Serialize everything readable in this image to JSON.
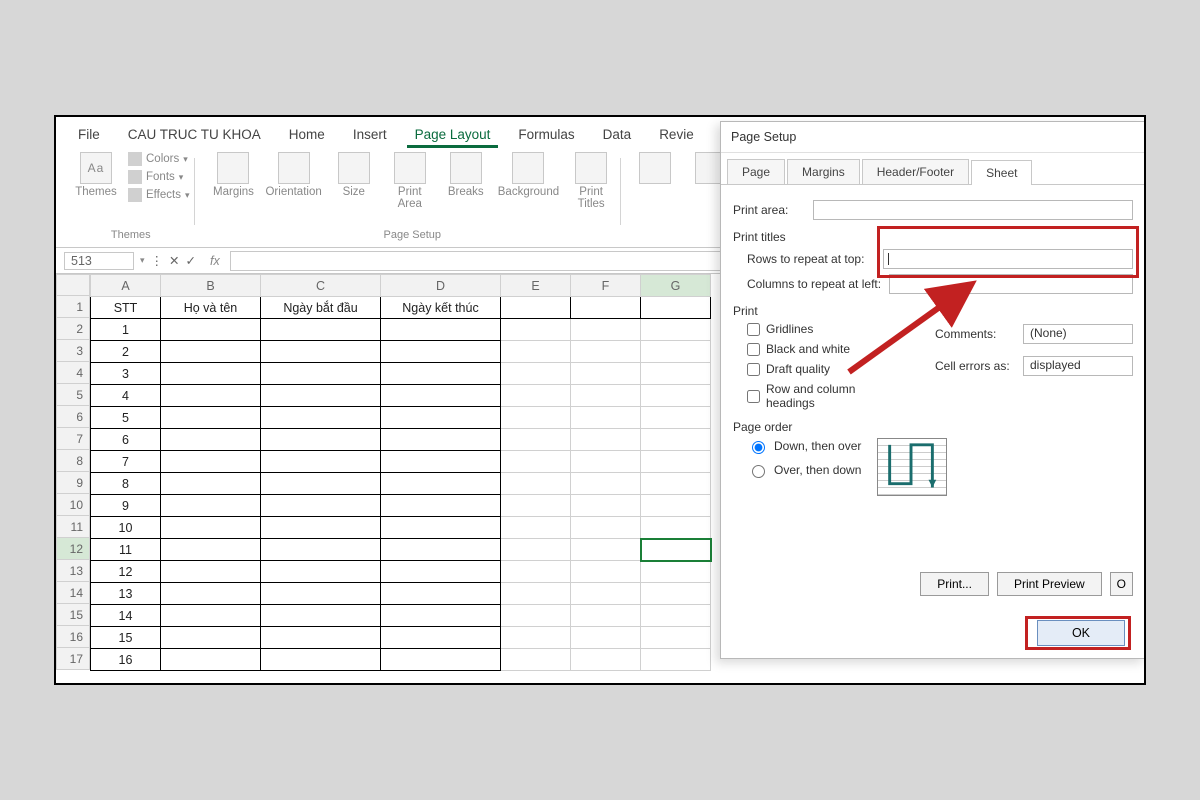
{
  "menu": {
    "file": "File",
    "cau": "CAU TRUC TU KHOA",
    "home": "Home",
    "insert": "Insert",
    "page_layout": "Page Layout",
    "formulas": "Formulas",
    "data": "Data",
    "review": "Revie"
  },
  "ribbon": {
    "themes_group": "Themes",
    "themes_btn": "Themes",
    "colors": "Colors",
    "fonts": "Fonts",
    "effects": "Effects",
    "page_setup_group": "Page Setup",
    "margins": "Margins",
    "orientation": "Orientation",
    "size": "Size",
    "print_area": "Print\nArea",
    "breaks": "Breaks",
    "background": "Background",
    "print_titles": "Print\nTitles"
  },
  "fx": {
    "name_box": "513",
    "fx_label": "fx"
  },
  "grid": {
    "col_A": "A",
    "col_B": "B",
    "col_C": "C",
    "col_D": "D",
    "col_E": "E",
    "col_F": "F",
    "col_G": "G",
    "hdr_A": "STT",
    "hdr_B": "Họ và tên",
    "hdr_C": "Ngày bắt đầu",
    "hdr_D": "Ngày kết thúc",
    "row_labels": [
      "",
      "1",
      "2",
      "3",
      "4",
      "5",
      "6",
      "7",
      "8",
      "9",
      "10",
      "11",
      "12",
      "13",
      "14",
      "15",
      "16",
      "17"
    ],
    "stt_values": [
      "1",
      "2",
      "3",
      "4",
      "5",
      "6",
      "7",
      "8",
      "9",
      "10",
      "11",
      "12",
      "13",
      "14",
      "15",
      "16"
    ]
  },
  "dialog": {
    "title": "Page Setup",
    "tab_page": "Page",
    "tab_margins": "Margins",
    "tab_header": "Header/Footer",
    "tab_sheet": "Sheet",
    "print_area_lbl": "Print area:",
    "print_titles_grp": "Print titles",
    "rows_top": "Rows to repeat at top:",
    "cols_left": "Columns to repeat at left:",
    "print_grp": "Print",
    "gridlines": "Gridlines",
    "bw": "Black and white",
    "draft": "Draft quality",
    "rowcol": "Row and column headings",
    "comments_lbl": "Comments:",
    "comments_val": "(None)",
    "errors_lbl": "Cell errors as:",
    "errors_val": "displayed",
    "order_grp": "Page order",
    "down_over": "Down, then over",
    "over_down": "Over, then down",
    "btn_print": "Print...",
    "btn_preview": "Print Preview",
    "btn_opt": "O",
    "btn_ok": "OK"
  }
}
